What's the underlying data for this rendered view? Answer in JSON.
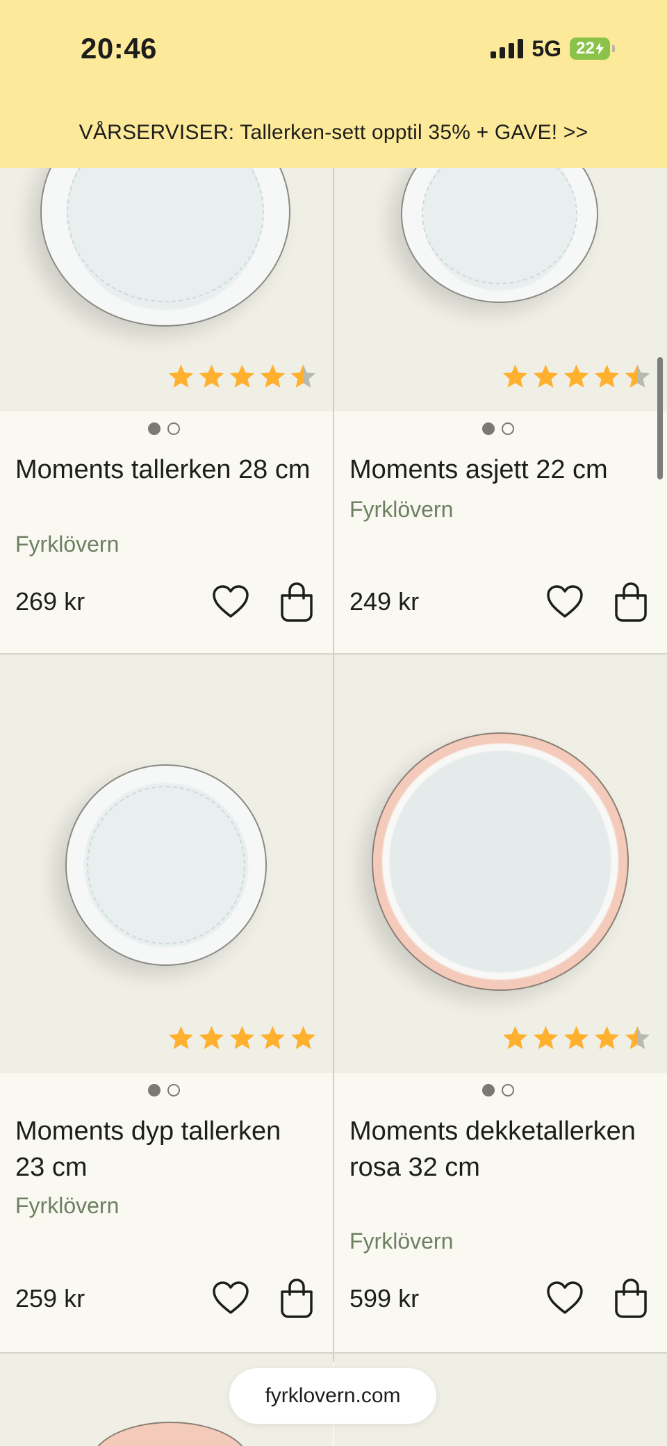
{
  "status_bar": {
    "time": "20:46",
    "network": "5G",
    "battery": "22"
  },
  "banner": {
    "text": "VÅRSERVISER: Tallerken-sett opptil 35% + GAVE! >>"
  },
  "colors": {
    "header_bg": "#fde99a",
    "star": "#ffb02e",
    "brand_text": "#6e7f62"
  },
  "products": [
    {
      "title": "Moments tallerken 28 cm",
      "brand": "Fyrklövern",
      "price": "269 kr",
      "rating": 4.5,
      "image_slides": 2,
      "active_slide": 1
    },
    {
      "title": "Moments asjett 22 cm",
      "brand": "Fyrklövern",
      "price": "249 kr",
      "rating": 4.5,
      "image_slides": 2,
      "active_slide": 1
    },
    {
      "title": "Moments dyp tallerken 23 cm",
      "brand": "Fyrklövern",
      "price": "259 kr",
      "rating": 5,
      "image_slides": 2,
      "active_slide": 1
    },
    {
      "title": "Moments dekketallerken rosa 32 cm",
      "brand": "Fyrklövern",
      "price": "599 kr",
      "rating": 4.5,
      "image_slides": 2,
      "active_slide": 1
    }
  ],
  "icons": {
    "wishlist": "heart-outline-icon",
    "cart": "shopping-bag-icon"
  },
  "browser": {
    "url": "fyrklovern.com"
  }
}
